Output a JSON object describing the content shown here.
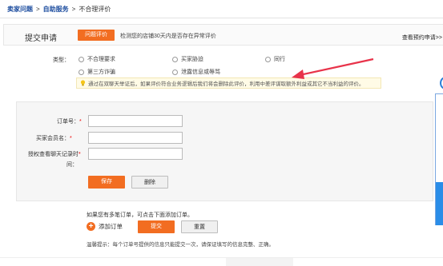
{
  "breadcrumb": {
    "home": "卖家问题",
    "section": "自助服务",
    "current": "不合理评价",
    "sep": ">"
  },
  "header": {
    "title": "提交申请",
    "tab_button": "问题评价",
    "description": "检测您的店铺30天内是否存在异常评价",
    "right_link": "查看预约申请>>"
  },
  "type_label": "类型：",
  "types": [
    "不合理要求",
    "买家胁迫",
    "同行",
    "第三方诈骗",
    "泄露信息或辱骂"
  ],
  "tip": "通过在双聊天举证后，如果评价符合业务逻辑后我们将会删除此评价，利用中差评谋取额外利益或其它不当利益的评价。",
  "form": {
    "order_label": "订单号：",
    "buyer_label": "买家会员名：",
    "chat_label_1": "授权查看聊天记录时",
    "chat_label_2": "间：",
    "req_mark": "*",
    "save_button": "保存",
    "delete_button": "删除"
  },
  "note": "如果您有多笔订单，可点击下面添加订单。",
  "add_order": "添加订单",
  "add_order_icon": "plus-icon",
  "submit_button": "提交",
  "reset_button": "重置",
  "warm_tip": "温馨提示：每个订单号提供的信息只能提交一次，请保证填写的信息完整、正确。",
  "colors": {
    "accent": "#f26d21",
    "link": "#1f4fa0",
    "arrow": "#e8334a",
    "side": "#2a8de8"
  }
}
